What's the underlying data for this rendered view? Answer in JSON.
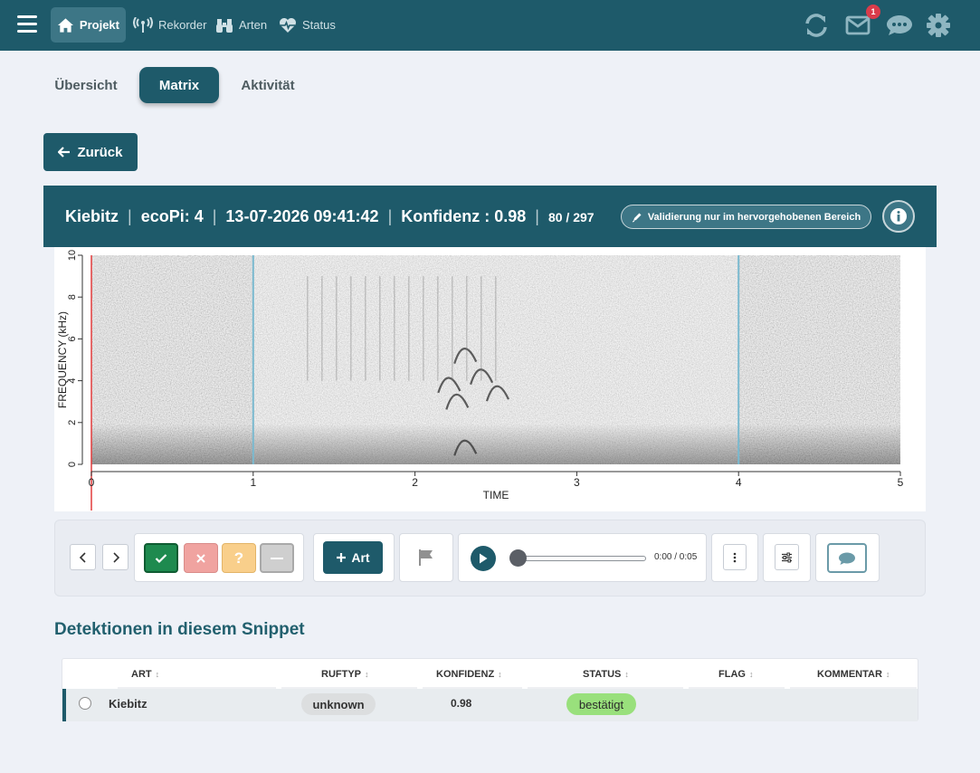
{
  "nav": {
    "items": [
      {
        "label": "Projekt",
        "icon": "home-icon",
        "active": true
      },
      {
        "label": "Rekorder",
        "icon": "antenna-icon",
        "active": false
      },
      {
        "label": "Arten",
        "icon": "binoculars-icon",
        "active": false
      },
      {
        "label": "Status",
        "icon": "heartbeat-icon",
        "active": false
      }
    ],
    "mail_badge": "1"
  },
  "tabs": [
    {
      "label": "Übersicht",
      "active": false
    },
    {
      "label": "Matrix",
      "active": true
    },
    {
      "label": "Aktivität",
      "active": false
    }
  ],
  "back_label": "Zurück",
  "detail": {
    "species": "Kiebitz",
    "device": "ecoPi: 4",
    "datetime": "13-07-2026 09:41:42",
    "confidence": "Konfidenz : 0.98",
    "position": "80 / 297",
    "validate_label": "Validierung nur im hervorgehobenen Bereich"
  },
  "spectrogram": {
    "ylabel": "FREQUENCY (kHz)",
    "xlabel": "TIME",
    "y_ticks": [
      "0",
      "2",
      "4",
      "6",
      "8",
      "10"
    ],
    "x_ticks": [
      "0",
      "1",
      "2",
      "3",
      "4",
      "5"
    ],
    "highlight_range": [
      1,
      4
    ],
    "time_range": [
      0,
      5
    ],
    "freq_range": [
      0,
      10
    ]
  },
  "controls": {
    "add_art_label": "Art",
    "time": "0:00 / 0:05",
    "progress": 0,
    "colors": {
      "confirm": "#1e8a4f",
      "reject": "#f0a3a0",
      "unsure": "#f9cf8b",
      "neutral": "#cfcfcf"
    }
  },
  "detections": {
    "title": "Detektionen in diesem Snippet",
    "headers": [
      "ART",
      "RUFTYP",
      "KONFIDENZ",
      "STATUS",
      "FLAG",
      "KOMMENTAR"
    ],
    "rows": [
      {
        "art": "Kiebitz",
        "ruftyp": "unknown",
        "konfidenz": "0.98",
        "status": "bestätigt",
        "flag": "",
        "kommentar": ""
      }
    ]
  }
}
